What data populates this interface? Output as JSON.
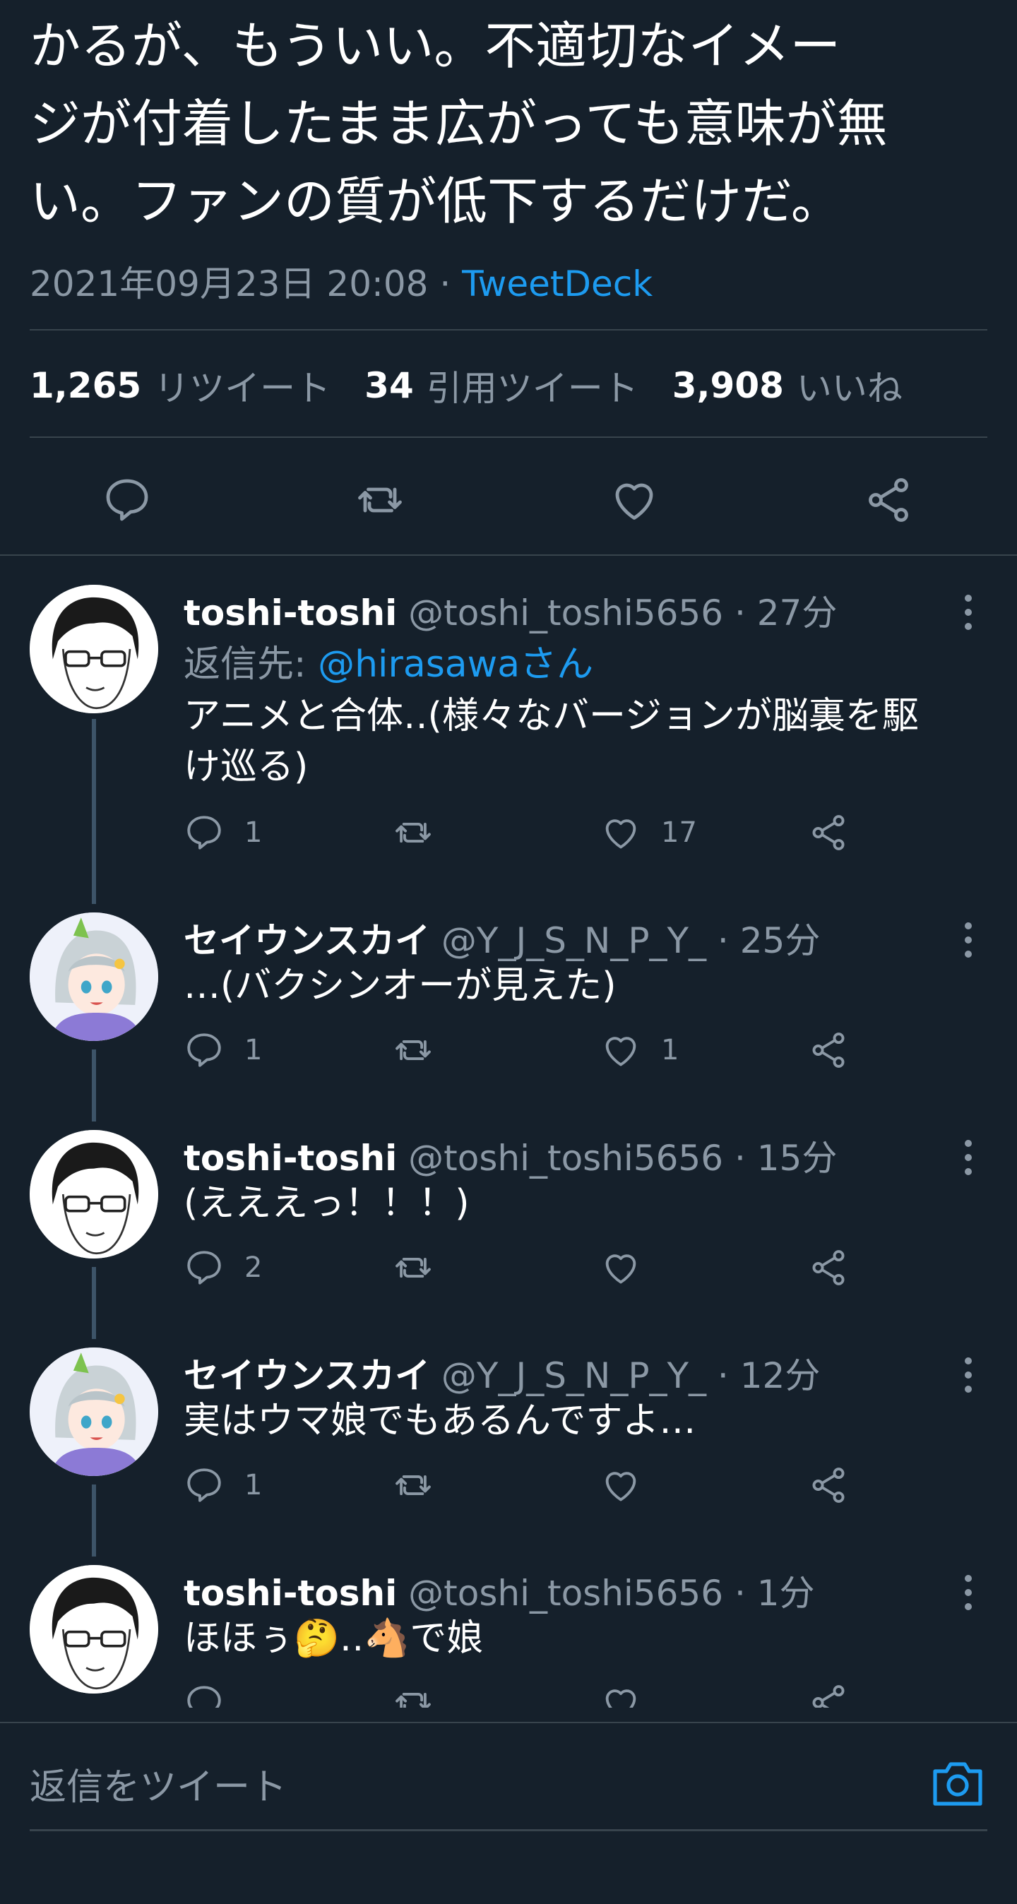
{
  "main_tweet": {
    "text": "かるが、もういい。不適切なイメー\nジが付着したまま広がっても意味が無\nい。ファンの質が低下するだけだ。",
    "timestamp": "2021年09月23日 20:08",
    "separator": " · ",
    "source": "TweetDeck",
    "stats": {
      "retweets": "1,265",
      "retweets_label": "リツイート",
      "quotes": "34",
      "quotes_label": "引用ツイート",
      "likes": "3,908",
      "likes_label": "いいね"
    }
  },
  "replies": [
    {
      "name": "toshi-toshi",
      "handle": "@toshi_toshi5656 · 27分",
      "reply_to_prefix": "返信先: ",
      "reply_to": "@hirasawaさん",
      "text": "アニメと合体‥(様々なバージョンが脳裏を駆\nけ巡る)",
      "reply_count": "1",
      "like_count": "17"
    },
    {
      "name": "セイウンスカイ",
      "handle": "@Y_J_S_N_P_Y_ · 25分",
      "text": "…(バクシンオーが見えた)",
      "reply_count": "1",
      "like_count": "1"
    },
    {
      "name": "toshi-toshi",
      "handle": "@toshi_toshi5656 · 15分",
      "text": "(えええっ！！！)",
      "reply_count": "2",
      "like_count": ""
    },
    {
      "name": "セイウンスカイ",
      "handle": "@Y_J_S_N_P_Y_ · 12分",
      "text": "実はウマ娘でもあるんですよ…",
      "reply_count": "1",
      "like_count": ""
    },
    {
      "name": "toshi-toshi",
      "handle": "@toshi_toshi5656 · 1分",
      "text": "ほほぅ🤔‥🐴で娘",
      "reply_count": "",
      "like_count": ""
    }
  ],
  "compose": {
    "placeholder": "返信をツイート"
  },
  "colors": {
    "background": "#15202b",
    "accent": "#1d9bf0",
    "muted": "#8b98a5",
    "divider": "#38444d"
  },
  "icons": [
    "reply-icon",
    "retweet-icon",
    "like-icon",
    "share-icon",
    "more-icon",
    "camera-icon"
  ]
}
